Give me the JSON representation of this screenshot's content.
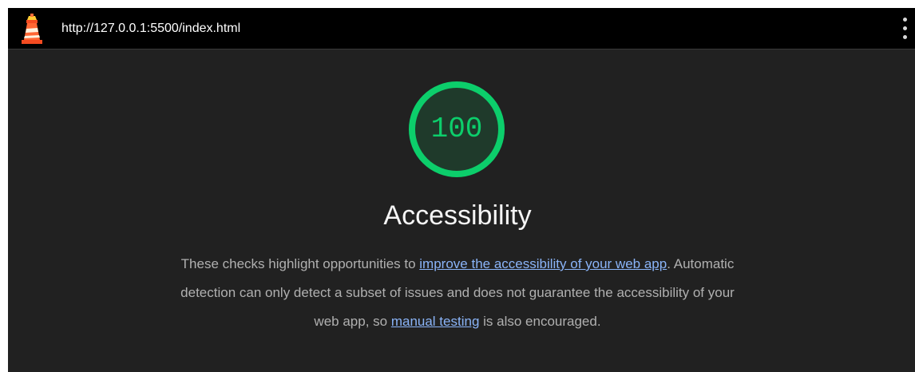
{
  "topbar": {
    "url": "http://127.0.0.1:5500/index.html",
    "logo_icon": "lighthouse-icon",
    "menu_icon": "more-vert-icon"
  },
  "score": {
    "value": "100",
    "color": "#0cce6b",
    "fraction": 1.0
  },
  "category": {
    "title": "Accessibility",
    "desc_part1": "These checks highlight opportunities to ",
    "link1": "improve the accessibility of your web app",
    "desc_part2": ". Automatic detection can only detect a subset of issues and does not guarantee the accessibility of your web app, so ",
    "link2": "manual testing",
    "desc_part3": " is also encouraged."
  },
  "colors": {
    "background": "#212121",
    "topbar": "#000000",
    "link": "#8ab4f8",
    "pass": "#0cce6b"
  }
}
